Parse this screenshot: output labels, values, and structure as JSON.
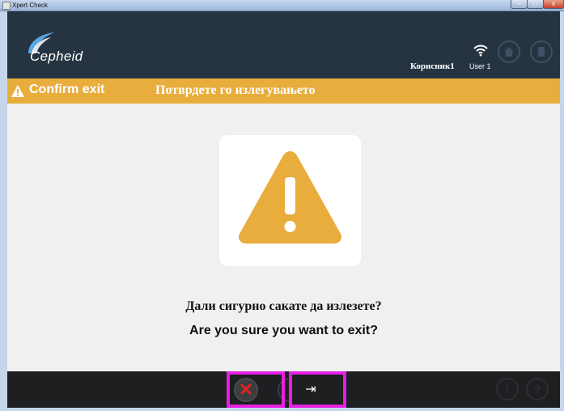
{
  "window": {
    "title": "Xpert Check",
    "minimize": "–",
    "maximize": "□",
    "close": "x"
  },
  "header": {
    "logo_text": "Cepheid",
    "user_local": "Корисник1",
    "user_en": "User 1",
    "home_icon": "home-icon",
    "exit_icon": "door-exit-icon"
  },
  "banner": {
    "title_en": "Confirm exit",
    "title_mk": "Потврдете го излегувањето",
    "color": "#e8ad3c"
  },
  "main": {
    "question_mk": "Дали сигурно сакате да излезете?",
    "question_en": "Are you sure you want to exit?",
    "icon": "warning-icon"
  },
  "footer": {
    "cancel_glyph": "✕",
    "exit_glyph": "⇥",
    "info_glyph": "i",
    "help_glyph": "?"
  }
}
